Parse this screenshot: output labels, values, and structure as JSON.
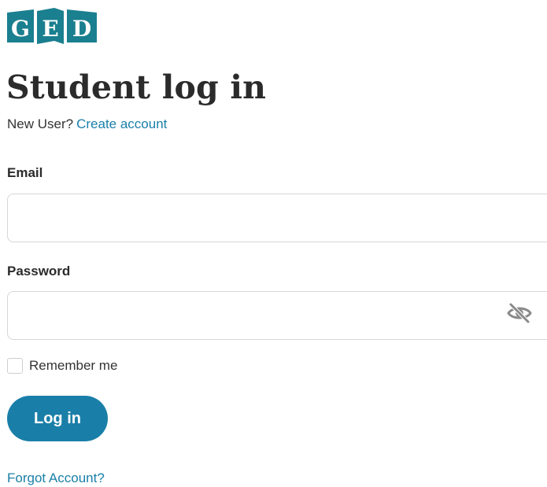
{
  "brand": {
    "logo_letters": [
      "G",
      "E",
      "D"
    ],
    "logo_color": "#1a7f8f"
  },
  "header": {
    "title": "Student log in",
    "new_user_text": "New User?",
    "create_account_link": "Create account"
  },
  "form": {
    "email_label": "Email",
    "email_value": "",
    "password_label": "Password",
    "password_value": "",
    "password_visibility_icon": "eye-off-icon",
    "remember_me_label": "Remember me",
    "remember_me_checked": false,
    "submit_label": "Log in",
    "forgot_link": "Forgot Account?"
  },
  "colors": {
    "accent": "#1a7fa8",
    "text": "#2b2b2b",
    "border": "#d6d6d6"
  }
}
